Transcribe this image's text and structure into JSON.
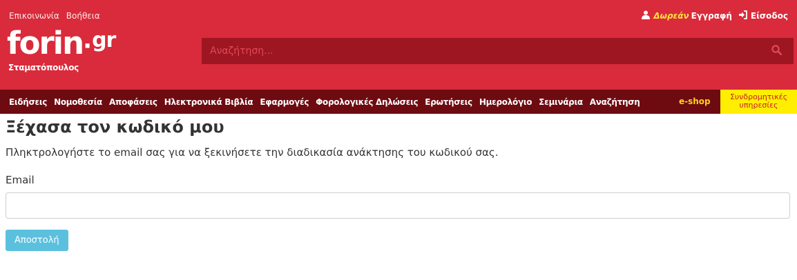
{
  "header": {
    "top_links": [
      "Επικοινωνία",
      "Βοήθεια"
    ],
    "account": {
      "free_label": "Δωρεάν",
      "register_label": "Εγγραφή",
      "login_label": "Είσοδος"
    },
    "logo": {
      "main": "forin",
      "dot": "·",
      "suffix": "gr",
      "subtitle": "Σταματόπουλος"
    },
    "search": {
      "placeholder": "Αναζήτηση..."
    }
  },
  "nav": {
    "items": [
      "Ειδήσεις",
      "Νομοθεσία",
      "Αποφάσεις",
      "Ηλεκτρονικά Βιβλία",
      "Εφαρμογές",
      "Φορολογικές Δηλώσεις",
      "Ερωτήσεις",
      "Ημερολόγιο",
      "Σεμινάρια",
      "Αναζήτηση"
    ],
    "eshop_label": "e-shop",
    "subscriptions_line1": "Συνδρομητικές",
    "subscriptions_line2": "υπηρεσίες"
  },
  "main": {
    "title": "Ξέχασα τον κωδικό μου",
    "intro": "Πληκτρολογήστε το email σας για να ξεκινήσετε την διαδικασία ανάκτησης του κωδικού σας.",
    "email_label": "Email",
    "email_value": "",
    "submit_label": "Αποστολή"
  },
  "colors": {
    "brand_red": "#d92b3b",
    "search_bg": "#9e1621",
    "nav_bg": "#6e0b11",
    "accent_yellow": "#ffee00",
    "button_blue": "#5bc0de"
  },
  "icons": [
    "user-icon",
    "sign-in-icon",
    "search-icon"
  ]
}
